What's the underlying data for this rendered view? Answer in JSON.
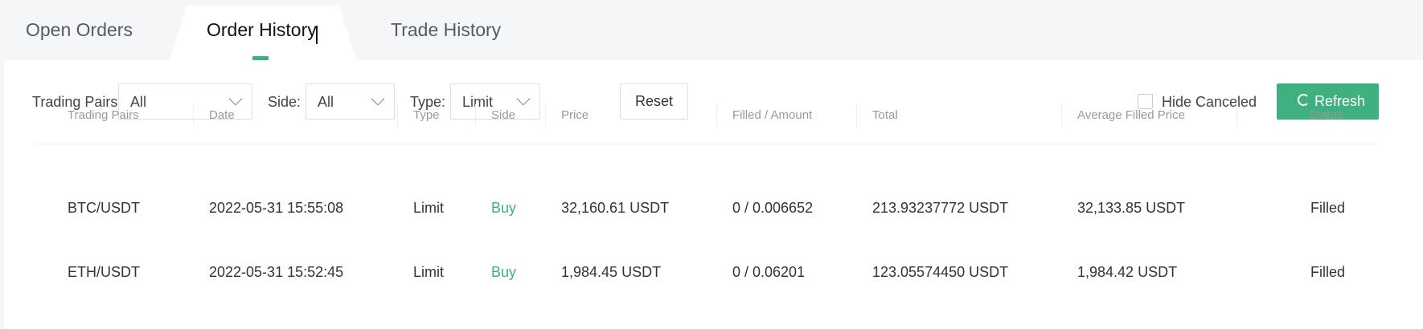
{
  "tabs": [
    {
      "label": "Open Orders"
    },
    {
      "label": "Order History"
    },
    {
      "label": "Trade History"
    }
  ],
  "filters": {
    "trading_pairs_label": "Trading Pairs",
    "trading_pairs_value": "All",
    "side_label": "Side",
    "side_value": "All",
    "type_label": "Type",
    "type_value": "Limit",
    "reset_label": "Reset",
    "hide_canceled_label": "Hide Canceled",
    "refresh_label": "Refresh"
  },
  "table": {
    "headers": [
      "Trading Pairs",
      "Date",
      "Type",
      "Side",
      "Price",
      "Filled / Amount",
      "Total",
      "Average Filled Price",
      "Status"
    ],
    "rows": [
      [
        "BTC/USDT",
        "2022-05-31 15:55:08",
        "Limit",
        "Buy",
        "32,160.61 USDT",
        "0 / 0.006652",
        "213.93237772 USDT",
        "32,133.85 USDT",
        "Filled"
      ],
      [
        "ETH/USDT",
        "2022-05-31 15:52:45",
        "Limit",
        "Buy",
        "1,984.45 USDT",
        "0 / 0.06201",
        "123.05574450 USDT",
        "1,984.42 USDT",
        "Filled"
      ]
    ]
  },
  "colors": {
    "accent": "#3fb07f"
  }
}
